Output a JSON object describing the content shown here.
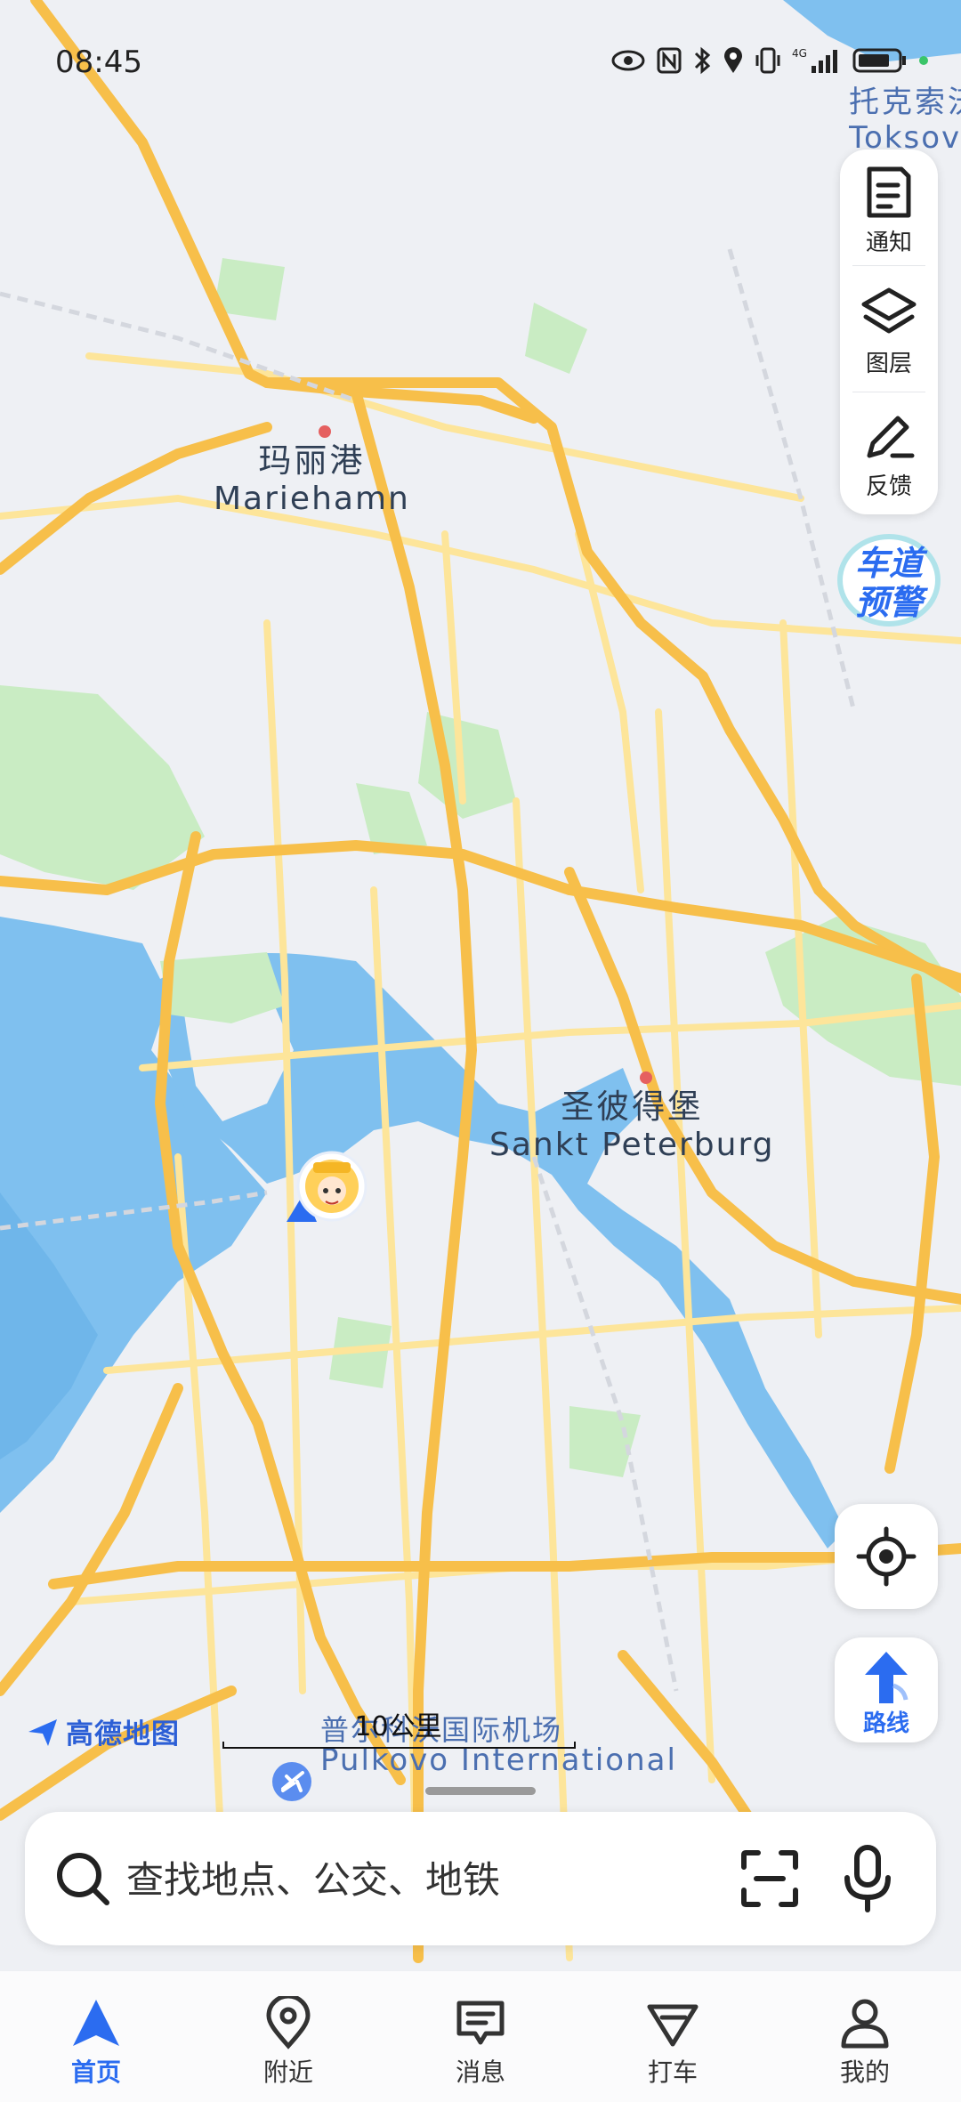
{
  "status_bar": {
    "time": "08:45",
    "icons": [
      "eye-icon",
      "nfc-icon",
      "bluetooth-icon",
      "location-icon",
      "vibrate-icon",
      "signal-4g-icon",
      "battery-icon"
    ],
    "network": "4G"
  },
  "map": {
    "labels": {
      "mariehamn_zh": "玛丽港",
      "mariehamn_en": "Mariehamn",
      "spb_zh": "圣彼得堡",
      "spb_en": "Sankt Peterburg",
      "toksovo_zh": "托克索沃",
      "toksovo_en": "Toksovo",
      "airport_zh": "普尔科沃国际机场",
      "airport_en": "Pulkovo International"
    },
    "scale": "10公里",
    "brand": "高德地图",
    "colors": {
      "water": "#7fc0ef",
      "land": "#eef0f4",
      "park": "#c9ecc3",
      "road_major": "#f7bf4a",
      "road_minor": "#fde59a"
    }
  },
  "tools": {
    "notify": "通知",
    "layers": "图层",
    "feedback": "反馈",
    "lane_warning_line1": "车道",
    "lane_warning_line2": "预警"
  },
  "route_label": "路线",
  "search": {
    "placeholder": "查找地点、公交、地铁"
  },
  "nav": {
    "home": "首页",
    "nearby": "附近",
    "messages": "消息",
    "taxi": "打车",
    "mine": "我的"
  },
  "accent_color": "#2b6cf0"
}
